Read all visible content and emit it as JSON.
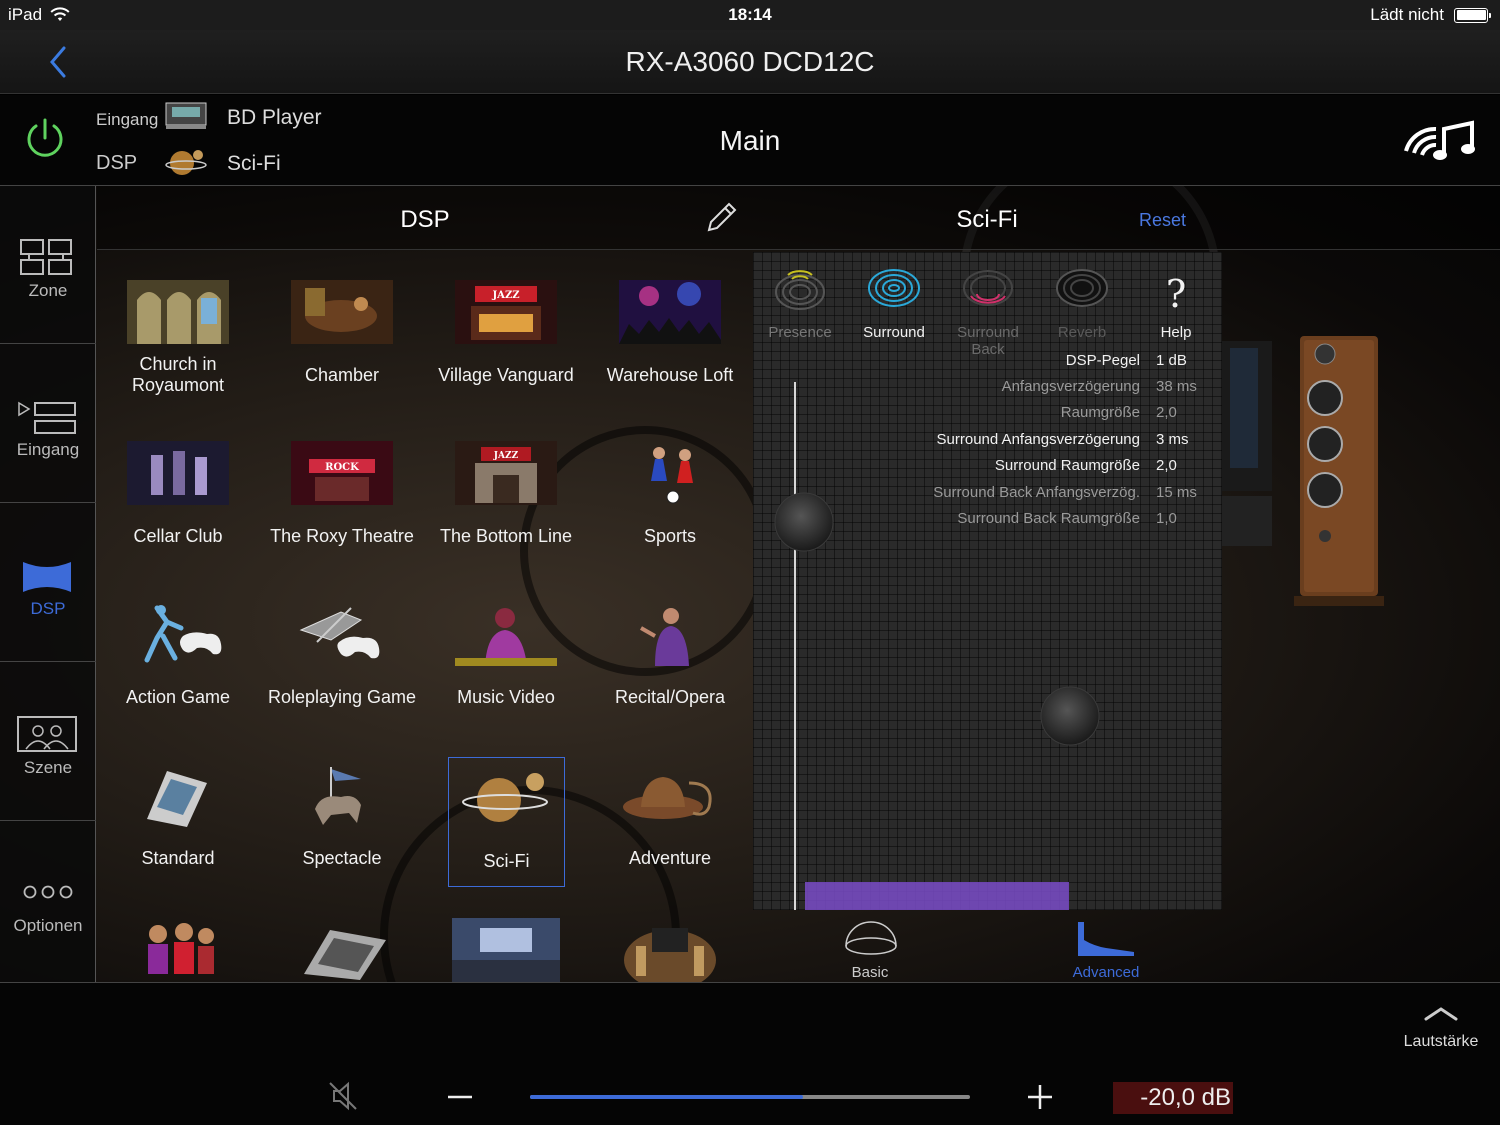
{
  "status_bar": {
    "device": "iPad",
    "time": "18:14",
    "charging": "Lädt nicht"
  },
  "nav": {
    "title": "RX-A3060 DCD12C"
  },
  "header": {
    "input_label": "Eingang",
    "input_value": "BD Player",
    "dsp_label": "DSP",
    "dsp_value": "Sci-Fi",
    "zone": "Main"
  },
  "sidebar": {
    "items": [
      {
        "label": "Zone"
      },
      {
        "label": "Eingang"
      },
      {
        "label": "DSP",
        "active": true
      },
      {
        "label": "Szene"
      },
      {
        "label": "Optionen"
      }
    ]
  },
  "dsp_header": {
    "title": "DSP",
    "program": "Sci-Fi",
    "reset": "Reset"
  },
  "programs": [
    {
      "name": "Church in Royaumont"
    },
    {
      "name": "Chamber"
    },
    {
      "name": "Village Vanguard"
    },
    {
      "name": "Warehouse Loft"
    },
    {
      "name": "Cellar Club"
    },
    {
      "name": "The Roxy Theatre"
    },
    {
      "name": "The Bottom Line"
    },
    {
      "name": "Sports"
    },
    {
      "name": "Action Game"
    },
    {
      "name": "Roleplaying Game"
    },
    {
      "name": "Music Video"
    },
    {
      "name": "Recital/Opera"
    },
    {
      "name": "Standard"
    },
    {
      "name": "Spectacle"
    },
    {
      "name": "Sci-Fi",
      "selected": true
    },
    {
      "name": "Adventure"
    }
  ],
  "sound_field": {
    "buttons": [
      {
        "label": "Presence",
        "enabled": false,
        "color": "#c8c020"
      },
      {
        "label": "Surround",
        "enabled": true,
        "color": "#2aa8d8"
      },
      {
        "label": "Surround Back",
        "enabled": false,
        "color": "#d0306a"
      },
      {
        "label": "Reverb",
        "enabled": false,
        "color": "#555555"
      },
      {
        "label": "Help",
        "enabled": true
      }
    ],
    "params": [
      {
        "name": "DSP-Pegel",
        "value": "1 dB",
        "highlight": true
      },
      {
        "name": "Anfangsverzögerung",
        "value": "38 ms",
        "highlight": false
      },
      {
        "name": "Raumgröße",
        "value": "2,0",
        "highlight": false
      },
      {
        "name": "Surround Anfangsverzögerung",
        "value": "3 ms",
        "highlight": true
      },
      {
        "name": "Surround Raumgröße",
        "value": "2,0",
        "highlight": true
      },
      {
        "name": "Surround Back Anfangsverzög.",
        "value": "15 ms",
        "highlight": false
      },
      {
        "name": "Surround Back Raumgröße",
        "value": "1,0",
        "highlight": false
      }
    ]
  },
  "modes": [
    {
      "label": "Basic",
      "active": false
    },
    {
      "label": "Advanced",
      "active": true
    }
  ],
  "footer": {
    "volume_toggle": "Lautstärke",
    "volume_display": "-20,0 dB",
    "volume_level": 0.62
  },
  "colors": {
    "accent": "#3d6bd8",
    "power": "#5fd35f",
    "graph": "#1fb3e0"
  }
}
